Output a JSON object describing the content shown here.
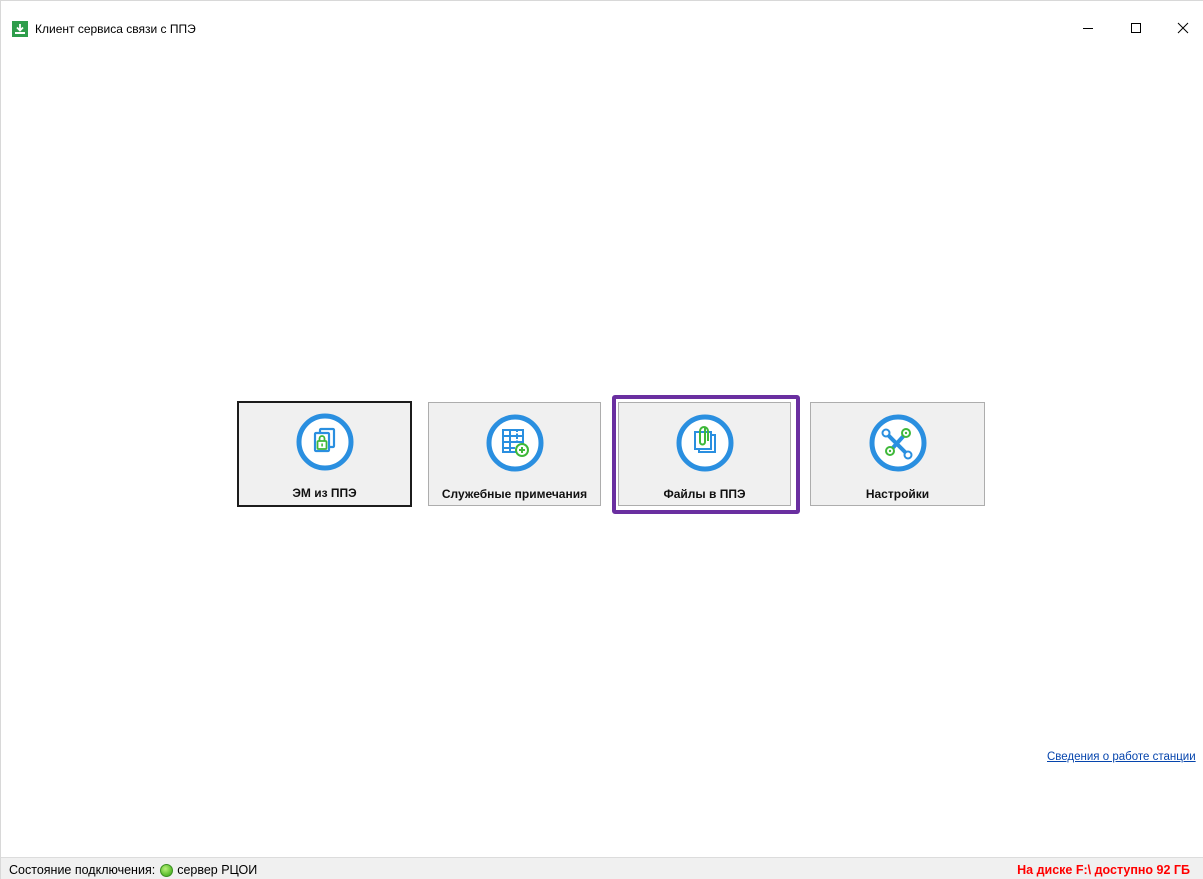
{
  "window": {
    "title": "Клиент сервиса связи с ППЭ",
    "icon": "download-icon",
    "controls": {
      "minimize": "minimize-icon",
      "maximize": "maximize-icon",
      "close": "close-icon"
    }
  },
  "tiles": [
    {
      "label": "ЭМ из ППЭ",
      "icon": "locked-documents-icon",
      "active": true
    },
    {
      "label": "Служебные примечания",
      "icon": "table-add-icon",
      "active": false
    },
    {
      "label": "Файлы в ППЭ",
      "icon": "paperclip-files-icon",
      "active": false,
      "highlighted": true
    },
    {
      "label": "Настройки",
      "icon": "wrench-gears-icon",
      "active": false
    }
  ],
  "links": {
    "station_info": "Сведения о работе станции"
  },
  "status": {
    "connection_label": "Состояние подключения:",
    "connection_state": "online",
    "server_label": "сервер РЦОИ",
    "disk_info": "На диске F:\\ доступно 92 ГБ"
  },
  "colors": {
    "accent_blue": "#2a8fe0",
    "accent_green": "#3fb83a",
    "highlight_purple": "#6a2fa0",
    "disk_info_red": "#ff0000",
    "link_blue": "#0645ad"
  }
}
